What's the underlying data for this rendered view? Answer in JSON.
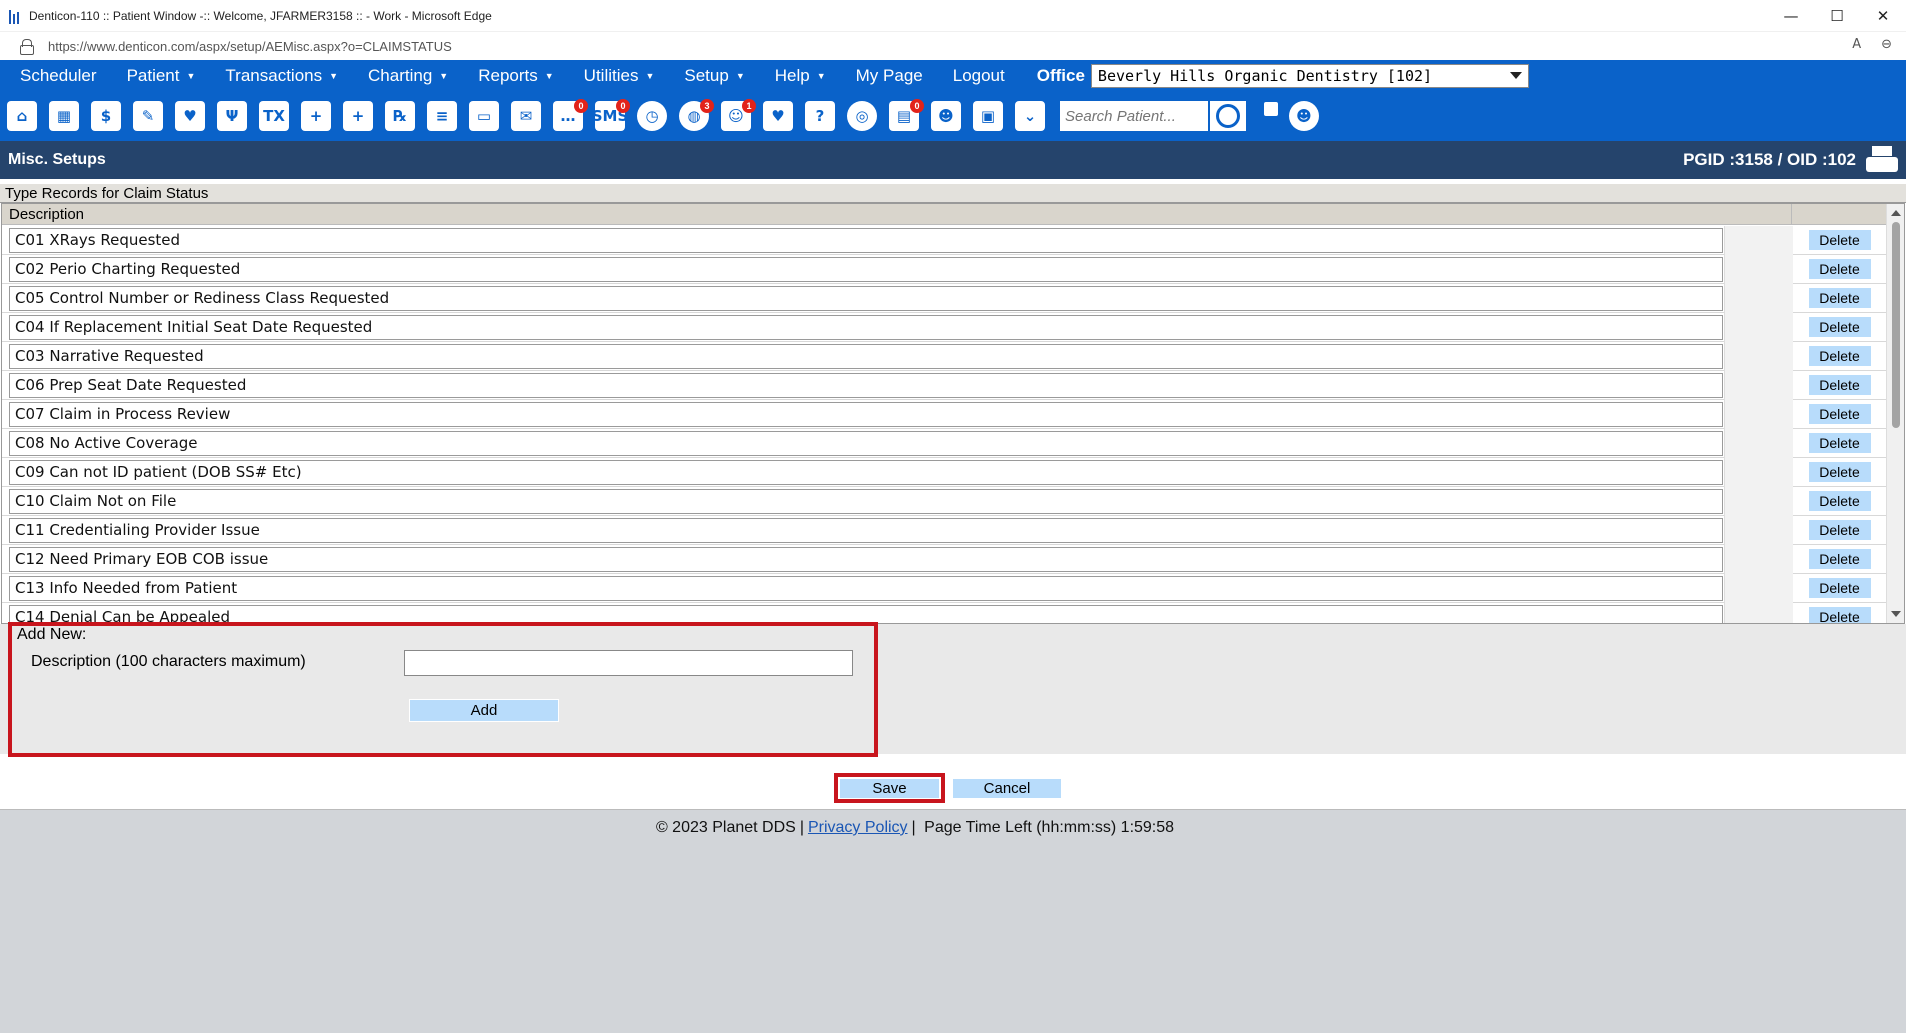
{
  "window": {
    "title": "Denticon-110 :: Patient Window -:: Welcome, JFARMER3158 :: - Work - Microsoft Edge",
    "url": "https://www.denticon.com/aspx/setup/AEMisc.aspx?o=CLAIMSTATUS"
  },
  "nav": {
    "items": [
      {
        "label": "Scheduler",
        "caret": false
      },
      {
        "label": "Patient",
        "caret": true
      },
      {
        "label": "Transactions",
        "caret": true
      },
      {
        "label": "Charting",
        "caret": true
      },
      {
        "label": "Reports",
        "caret": true
      },
      {
        "label": "Utilities",
        "caret": true
      },
      {
        "label": "Setup",
        "caret": true
      },
      {
        "label": "Help",
        "caret": true
      },
      {
        "label": "My Page",
        "caret": false
      },
      {
        "label": "Logout",
        "caret": false
      }
    ],
    "office_label": "Office",
    "office_value": "Beverly Hills Organic Dentistry [102]"
  },
  "toolbar": {
    "icons": [
      {
        "name": "home-icon",
        "glyph": "⌂",
        "badge": ""
      },
      {
        "name": "calendar-icon",
        "glyph": "▦",
        "badge": ""
      },
      {
        "name": "dollar-icon",
        "glyph": "$",
        "badge": ""
      },
      {
        "name": "edit-chart-icon",
        "glyph": "✎",
        "badge": ""
      },
      {
        "name": "tooth-icon",
        "glyph": "♥",
        "badge": ""
      },
      {
        "name": "tooth-roots-icon",
        "glyph": "Ψ",
        "badge": ""
      },
      {
        "name": "treatment-plan-icon",
        "glyph": "TX",
        "badge": ""
      },
      {
        "name": "add-patient-icon",
        "glyph": "+",
        "badge": ""
      },
      {
        "name": "family-add-icon",
        "glyph": "+",
        "badge": ""
      },
      {
        "name": "prescription-icon",
        "glyph": "℞",
        "badge": ""
      },
      {
        "name": "notes-icon",
        "glyph": "≡",
        "badge": ""
      },
      {
        "name": "document-icon",
        "glyph": "▭",
        "badge": ""
      },
      {
        "name": "mail-icon",
        "glyph": "✉",
        "badge": ""
      },
      {
        "name": "messages-icon",
        "glyph": "…",
        "badge": "0"
      },
      {
        "name": "sms-icon",
        "glyph": "SMS",
        "badge": "0"
      },
      {
        "name": "clock-icon",
        "glyph": "◷",
        "badge": ""
      },
      {
        "name": "globe-alerts-icon",
        "glyph": "◍",
        "badge": "3"
      },
      {
        "name": "recall-icon",
        "glyph": "☺",
        "badge": "1"
      },
      {
        "name": "tooth-chart-icon",
        "glyph": "♥",
        "badge": ""
      },
      {
        "name": "help-tooth-icon",
        "glyph": "?",
        "badge": ""
      },
      {
        "name": "web-icon",
        "glyph": "◎",
        "badge": ""
      },
      {
        "name": "forms-icon",
        "glyph": "▤",
        "badge": "0"
      },
      {
        "name": "group-icon",
        "glyph": "☻",
        "badge": ""
      },
      {
        "name": "printer-icon",
        "glyph": "▣",
        "badge": ""
      },
      {
        "name": "collapse-icon",
        "glyph": "⌄",
        "badge": ""
      }
    ],
    "search_placeholder": "Search Patient..."
  },
  "page": {
    "title": "Misc. Setups",
    "ids": "PGID :3158  /  OID :102"
  },
  "table": {
    "section_title": "Type Records for Claim Status",
    "column_header": "Description",
    "delete_label": "Delete",
    "rows": [
      "C01 XRays Requested",
      "C02 Perio Charting Requested",
      "C05 Control Number or Rediness Class Requested",
      "C04 If Replacement Initial Seat Date Requested",
      "C03 Narrative Requested",
      "C06 Prep Seat Date Requested",
      "C07 Claim in Process Review",
      "C08 No Active Coverage",
      "C09 Can not ID patient (DOB SS# Etc)",
      "C10 Claim Not on File",
      "C11 Credentialing Provider Issue",
      "C12 Need Primary EOB COB issue",
      "C13 Info Needed from Patient",
      "C14 Denial Can be Appealed"
    ]
  },
  "add_new": {
    "title": "Add New:",
    "description_label": "Description (100 characters maximum)",
    "description_value": "",
    "add_label": "Add"
  },
  "actions": {
    "save_label": "Save",
    "cancel_label": "Cancel"
  },
  "footer": {
    "copyright": "© 2023 Planet DDS",
    "privacy_label": "Privacy Policy",
    "time_left": "Page Time Left (hh:mm:ss) 1:59:58"
  },
  "colors": {
    "nav_blue": "#0a62c9",
    "header_navy": "#25446c",
    "button_blue": "#b8dcfb",
    "highlight_red": "#c8151d"
  }
}
